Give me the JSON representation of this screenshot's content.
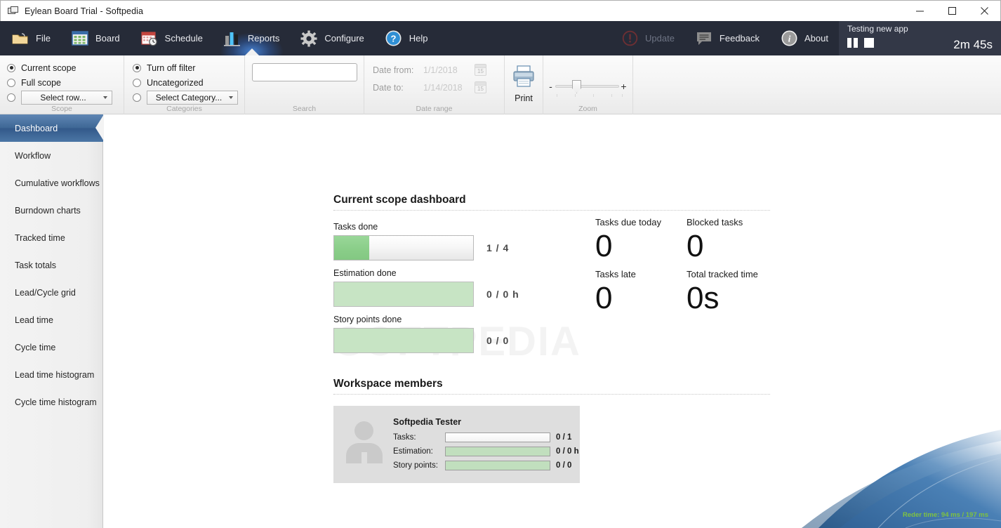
{
  "window": {
    "title": "Eylean Board Trial - Softpedia",
    "app_icon": "window-stack-icon",
    "minimize": "minimize-icon",
    "maximize": "maximize-icon",
    "close": "close-icon"
  },
  "ribbon": {
    "tabs": [
      {
        "label": "File",
        "icon": "folder-icon",
        "active": false
      },
      {
        "label": "Board",
        "icon": "board-grid-icon",
        "active": false
      },
      {
        "label": "Schedule",
        "icon": "calendar-clock-icon",
        "active": false
      },
      {
        "label": "Reports",
        "icon": "bar-chart-icon",
        "active": true
      },
      {
        "label": "Configure",
        "icon": "gear-icon",
        "active": false
      },
      {
        "label": "Help",
        "icon": "question-circle-icon",
        "active": false
      }
    ],
    "right_actions": [
      {
        "label": "Update",
        "icon": "exclamation-circle-icon",
        "disabled": true
      },
      {
        "label": "Feedback",
        "icon": "speech-bubble-icon",
        "disabled": false
      },
      {
        "label": "About",
        "icon": "info-circle-icon",
        "disabled": false
      }
    ],
    "timer": {
      "name": "Testing new app",
      "value": "2m 45s",
      "pause_icon": "pause-icon",
      "stop_icon": "stop-icon"
    }
  },
  "toolbar": {
    "scope": {
      "group_label": "Scope",
      "options": [
        {
          "label": "Current scope",
          "selected": true
        },
        {
          "label": "Full scope",
          "selected": false
        }
      ],
      "row_select": {
        "label": "Select row...",
        "selected": false
      }
    },
    "categories": {
      "group_label": "Categories",
      "options": [
        {
          "label": "Turn off filter",
          "selected": true
        },
        {
          "label": "Uncategorized",
          "selected": false
        }
      ],
      "category_select": {
        "label": "Select Category...",
        "selected": false
      }
    },
    "search": {
      "group_label": "Search",
      "value": "",
      "placeholder": ""
    },
    "date_range": {
      "group_label": "Date range",
      "from_label": "Date from:",
      "from_value": "1/1/2018",
      "to_label": "Date to:",
      "to_value": "1/14/2018",
      "calendar_day": "15"
    },
    "print": {
      "label": "Print",
      "icon": "printer-icon"
    },
    "zoom": {
      "group_label": "Zoom",
      "minus": "-",
      "plus": "+"
    }
  },
  "sidebar": {
    "items": [
      {
        "label": "Dashboard",
        "active": true
      },
      {
        "label": "Workflow",
        "active": false
      },
      {
        "label": "Cumulative workflows",
        "active": false
      },
      {
        "label": "Burndown charts",
        "active": false
      },
      {
        "label": "Tracked time",
        "active": false
      },
      {
        "label": "Task totals",
        "active": false
      },
      {
        "label": "Lead/Cycle grid",
        "active": false
      },
      {
        "label": "Lead time",
        "active": false
      },
      {
        "label": "Cycle time",
        "active": false
      },
      {
        "label": "Lead time histogram",
        "active": false
      },
      {
        "label": "Cycle time histogram",
        "active": false
      }
    ]
  },
  "dashboard": {
    "title": "Current scope dashboard",
    "progress": [
      {
        "label": "Tasks done",
        "value": "1 / 4",
        "percent": 25,
        "style": "partial"
      },
      {
        "label": "Estimation done",
        "value": "0 / 0 h",
        "percent": 100,
        "style": "full-green"
      },
      {
        "label": "Story points done",
        "value": "0 / 0",
        "percent": 100,
        "style": "full-green"
      }
    ],
    "stats": [
      {
        "label": "Tasks due today",
        "value": "0"
      },
      {
        "label": "Blocked tasks",
        "value": "0"
      },
      {
        "label": "Tasks late",
        "value": "0"
      },
      {
        "label": "Total tracked time",
        "value": "0s"
      }
    ],
    "members_title": "Workspace members",
    "members": [
      {
        "name": "Softpedia Tester",
        "avatar_icon": "user-avatar-icon",
        "rows": [
          {
            "label": "Tasks:",
            "value": "0 / 1",
            "style": "empty"
          },
          {
            "label": "Estimation:",
            "value": "0 / 0 h",
            "style": "green"
          },
          {
            "label": "Story points:",
            "value": "0 / 0",
            "style": "green"
          }
        ]
      }
    ],
    "watermark": "SOFTPEDIA",
    "render_time": "Reder time: 94 ms / 197 ms"
  },
  "colors": {
    "ribbon_dark": "#262b38",
    "accent_blue": "#3f6896",
    "progress_green": "#8ace89",
    "progress_green_light": "#c7e4c4",
    "render_time_green": "#7fc241"
  }
}
